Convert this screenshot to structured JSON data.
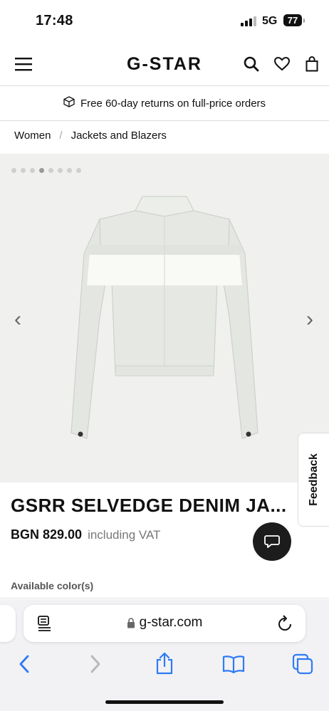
{
  "status": {
    "time": "17:48",
    "network": "5G",
    "battery": "77"
  },
  "header": {
    "logo": "G-STAR"
  },
  "promo": {
    "text": "Free 60-day returns on full-price orders"
  },
  "breadcrumb": {
    "items": [
      "Women",
      "Jackets and Blazers"
    ],
    "separator": "/"
  },
  "gallery": {
    "dot_count": 8,
    "active_index": 3,
    "prev_symbol": "‹",
    "next_symbol": "›"
  },
  "feedback": {
    "label": "Feedback"
  },
  "product": {
    "title": "GSRR SELVEDGE DENIM JA...",
    "price": "BGN 829.00",
    "vat_note": "including VAT",
    "colors_label": "Available color(s)"
  },
  "browser": {
    "url": "g-star.com"
  },
  "colors": {
    "accent": "#111111",
    "safari_blue": "#2f7bf5",
    "gallery_bg": "#f0f0ef"
  }
}
